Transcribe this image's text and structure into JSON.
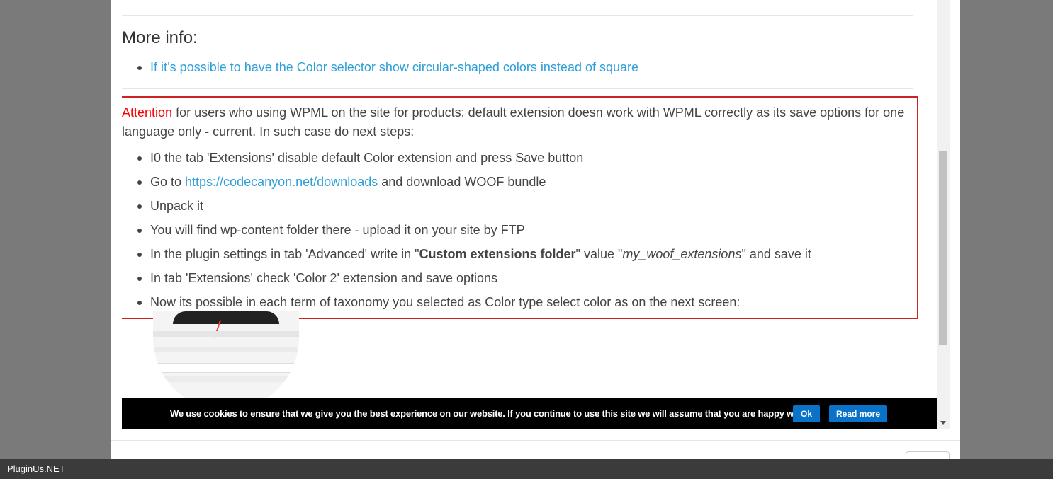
{
  "more_info": {
    "heading": "More info:",
    "link": "If it’s possible to have the Color selector show circular-shaped colors instead of square"
  },
  "attention": {
    "label": "Attention",
    "text": " for users who using WPML on the site for products: default extension doesn work with WPML correctly as its save options for one language only - current. In such case do next steps:",
    "steps": {
      "s1": "I0 the tab 'Extensions' disable default Color extension and press Save button",
      "s2_pre": "Go to ",
      "s2_link": "https://codecanyon.net/downloads",
      "s2_post": " and download WOOF bundle",
      "s3": "Unpack it",
      "s4": "You will find wp-content folder there - upload it on your site by FTP",
      "s5_pre": "In the plugin settings in tab 'Advanced' write in \"",
      "s5_bold": "Custom extensions folder",
      "s5_mid": "\" value \"",
      "s5_italic": "my_woof_extensions",
      "s5_post": "\" and save it",
      "s6": "In tab 'Extensions' check 'Color 2' extension and save options",
      "s7": "Now its possible in each term of taxonomy you selected as Color type select color as on the next screen:"
    }
  },
  "cookie": {
    "text": "We use cookies to ensure that we give you the best experience on our website. If you continue to use this site we will assume that you are happy with it.",
    "ok_label": "Ok",
    "read_more_label": "Read more"
  },
  "statusbar": {
    "label": "PluginUs.NET"
  },
  "colors": {
    "attention_red": "#ff0000",
    "link_blue": "#2e9fd8",
    "box_border": "#cf2121",
    "button_blue": "#0a72c9"
  }
}
